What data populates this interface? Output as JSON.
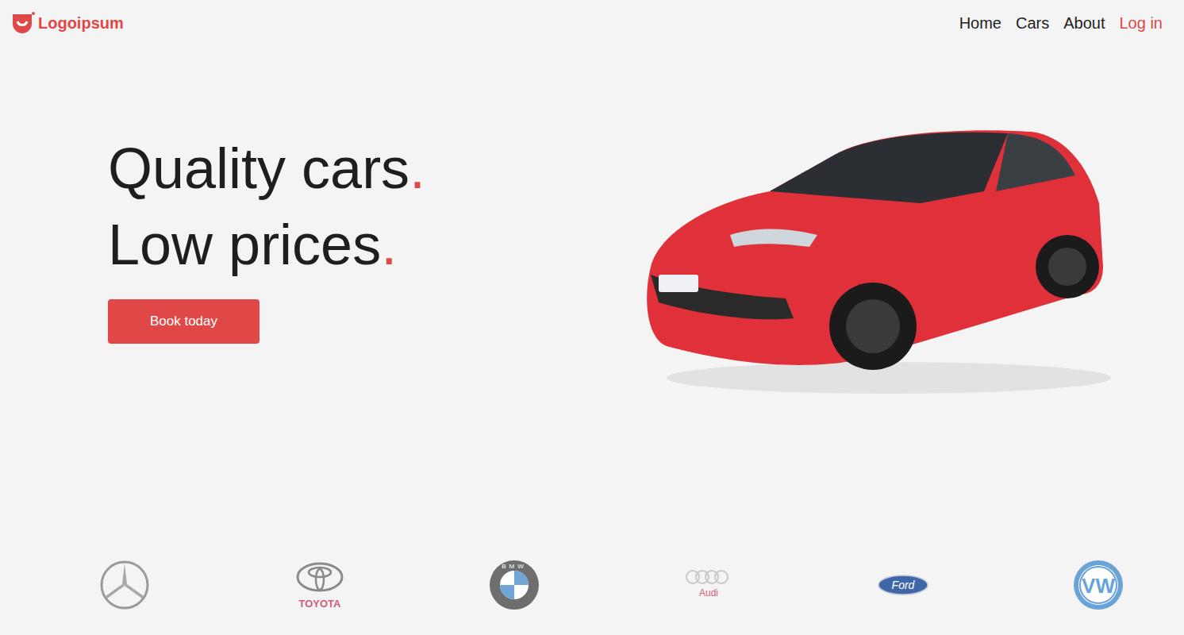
{
  "header": {
    "logo": {
      "text": "Logoipsum"
    },
    "nav": [
      {
        "label": "Home",
        "kind": "link"
      },
      {
        "label": "Cars",
        "kind": "link"
      },
      {
        "label": "About",
        "kind": "link"
      },
      {
        "label": "Log in",
        "kind": "login"
      }
    ]
  },
  "hero": {
    "lines": [
      {
        "text": "Quality cars",
        "mark": "."
      },
      {
        "text": "Low prices",
        "mark": "."
      }
    ],
    "button": "Book today"
  },
  "brands": [
    {
      "kind": "mercedes"
    },
    {
      "kind": "toyota",
      "text": "TOYOTA"
    },
    {
      "kind": "bmw",
      "text": "BMW"
    },
    {
      "kind": "audi",
      "text": "Audi"
    },
    {
      "kind": "ford",
      "text": "Ford"
    },
    {
      "kind": "vw",
      "text": "VW"
    }
  ]
}
